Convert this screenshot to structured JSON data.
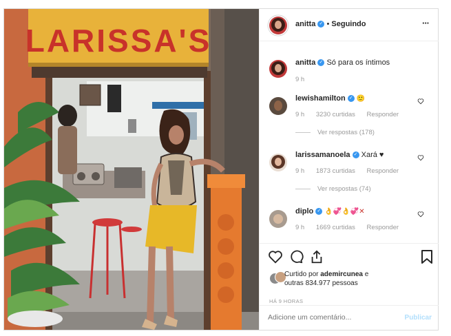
{
  "post": {
    "sign_text": "LARISSA'S"
  },
  "header": {
    "username": "anitta",
    "separator": "•",
    "follow_status": "Seguindo",
    "more": "···"
  },
  "caption": {
    "username": "anitta",
    "text": "Só para os íntimos",
    "time": "9 h"
  },
  "comments": [
    {
      "username": "lewishamilton",
      "text": "🙂",
      "time": "9 h",
      "likes": "3230 curtidas",
      "reply": "Responder",
      "view_replies": "Ver respostas (178)"
    },
    {
      "username": "larissamanoela",
      "text": "Xará ♥",
      "time": "9 h",
      "likes": "1873 curtidas",
      "reply": "Responder",
      "view_replies": "Ver respostas (74)"
    },
    {
      "username": "diplo",
      "text": "👌💞👌💞✕",
      "time": "9 h",
      "likes": "1669 curtidas",
      "reply": "Responder"
    }
  ],
  "likes_line": {
    "prefix": "Curtido por",
    "user": "ademircunea",
    "conj": "e",
    "others": "outras 834.977 pessoas"
  },
  "timestamp": "HÁ 9 HORAS",
  "add_comment": {
    "placeholder": "Adicione um comentário...",
    "publish": "Publicar"
  },
  "colors": {
    "verified": "#3897f0",
    "link_disabled": "#b2dffc",
    "sign_bg": "#e8b23a",
    "sign_text": "#c8322a"
  }
}
